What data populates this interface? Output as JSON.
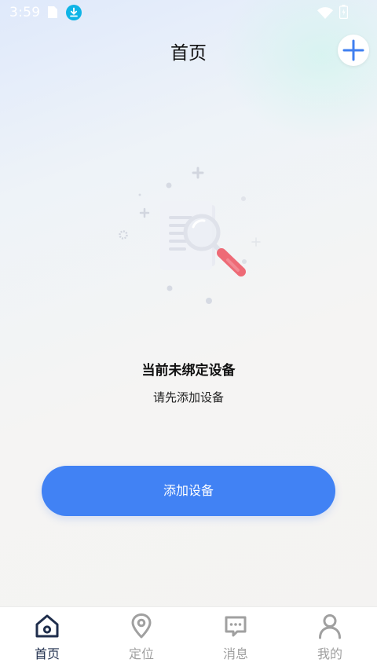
{
  "status_bar": {
    "time": "3:59"
  },
  "header": {
    "title": "首页"
  },
  "empty_state": {
    "title": "当前未绑定设备",
    "subtitle": "请先添加设备"
  },
  "actions": {
    "add_device_label": "添加设备"
  },
  "bottom_nav": {
    "items": [
      {
        "label": "首页",
        "icon": "home-icon",
        "active": true
      },
      {
        "label": "定位",
        "icon": "location-pin-icon",
        "active": false
      },
      {
        "label": "消息",
        "icon": "message-icon",
        "active": false
      },
      {
        "label": "我的",
        "icon": "person-icon",
        "active": false
      }
    ]
  },
  "colors": {
    "accent": "#4182f4",
    "nav_active": "#1f2e4c",
    "nav_inactive": "#a0a0a0",
    "download_badge": "#0fb4e6"
  }
}
